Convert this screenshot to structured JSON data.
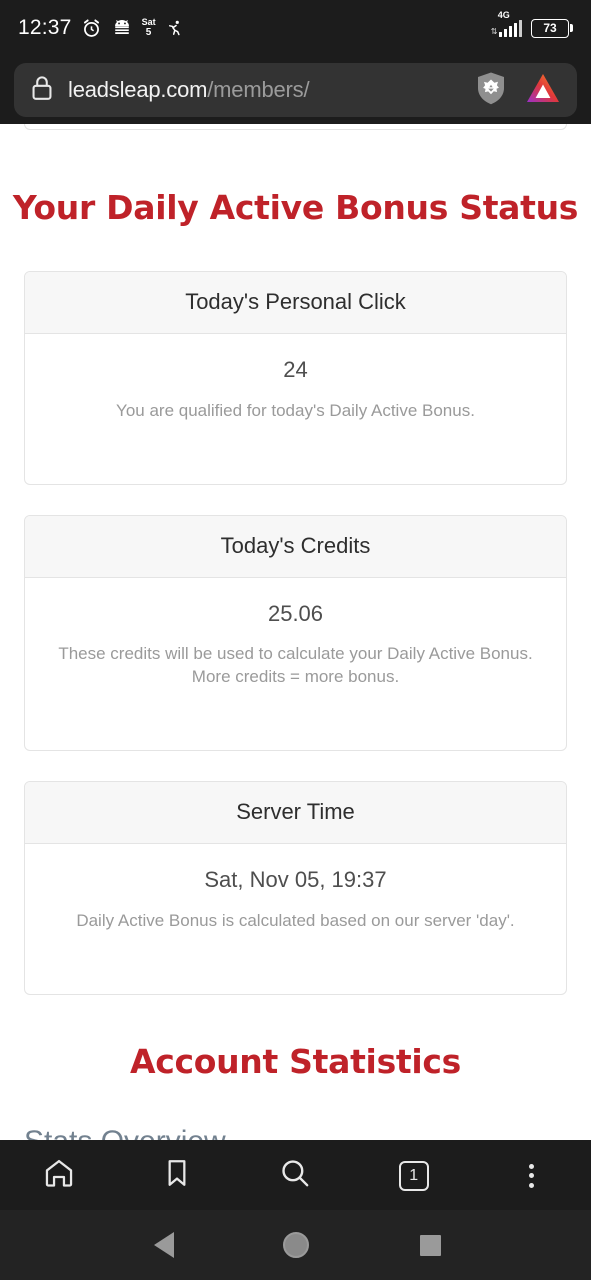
{
  "status_bar": {
    "clock": "12:37",
    "calendar_day": "Sat",
    "calendar_date": "5",
    "network_type": "4G",
    "battery_percent": "73",
    "icons": [
      "alarm-clock-icon",
      "android-body-icon",
      "calendar-icon",
      "activity-run-icon"
    ]
  },
  "url_bar": {
    "host": "leadsleap.com",
    "path": "/members/",
    "lock_icon": "lock-icon",
    "shield_icon": "brave-shield-lion-icon",
    "rewards_icon": "brave-bat-triangle-icon"
  },
  "page": {
    "bonus_heading": "Your Daily Active Bonus Status",
    "account_heading": "Account Statistics",
    "stats_overview_label": "Stats Overview",
    "accent_red": "#bf2229",
    "muted_text": "#9a9a9a",
    "cards": [
      {
        "title": "Today's Personal Click",
        "value": "24",
        "note": "You are qualified for today's Daily Active Bonus."
      },
      {
        "title": "Today's Credits",
        "value": "25.06",
        "note": "These credits will be used to calculate your Daily Active Bonus. More credits = more bonus."
      },
      {
        "title": "Server Time",
        "value": "Sat, Nov 05, 19:37",
        "note": "Daily Active Bonus is calculated based on our server 'day'."
      }
    ]
  },
  "browser_bar": {
    "home_label": "home-icon",
    "bookmarks_label": "bookmark-icon",
    "search_label": "search-icon",
    "tab_count": "1",
    "menu_label": "kebab-menu-icon"
  },
  "android_nav": {
    "back_label": "back-icon",
    "home_label": "home-circle-icon",
    "recents_label": "recents-square-icon"
  }
}
